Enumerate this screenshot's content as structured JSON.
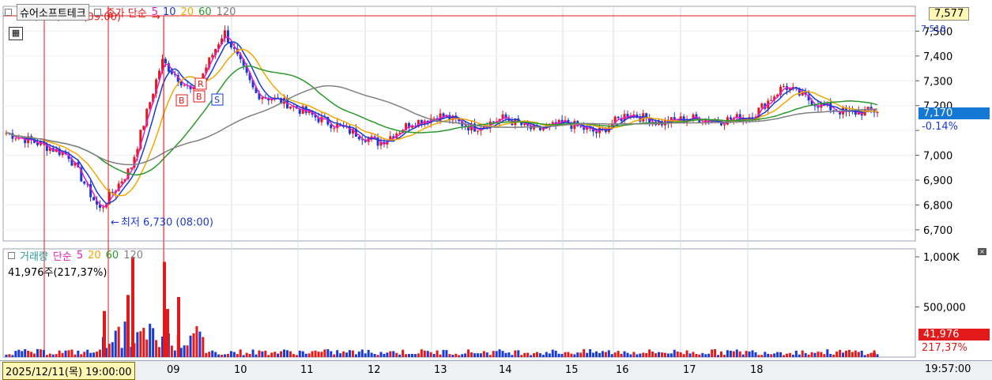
{
  "stock_name": "슈어소프트테크",
  "price_legend": {
    "label": "종가 단순",
    "ma": [
      "5",
      "10",
      "20",
      "60",
      "120"
    ]
  },
  "volume_legend": {
    "label": "거래량",
    "ma_label": "단순",
    "ma": [
      "5",
      "20",
      "60",
      "120"
    ]
  },
  "volume_info": "41,976주(217,37%)",
  "high_annotation": "최고 7,560 (09:00)",
  "low_annotation": "최저 6,730 (08:00)",
  "right_tags": {
    "ref_price": "7,577",
    "small_label": "7,510",
    "current_price": "7,170",
    "change_pct": "-0.14%",
    "volume": "41,976",
    "volume_pct": "217,37%",
    "time": "19:57:00"
  },
  "x_axis": {
    "cursor_label": "2025/12/11(목) 19:00:00",
    "dates": [
      "09",
      "10",
      "11",
      "12",
      "13",
      "14",
      "15",
      "16",
      "17",
      "18"
    ]
  },
  "colors": {
    "up": "#e21a1a",
    "down": "#1a3ad6",
    "ma5": "#e81ec4",
    "ma10": "#1a3ad6",
    "ma20": "#f2a800",
    "ma60": "#2a9a2a",
    "ma120": "#808080"
  },
  "signals": [
    "R",
    "B",
    "B",
    "S"
  ],
  "chart_data": [
    {
      "type": "line",
      "name": "price",
      "yticks": [
        6700,
        6800,
        6900,
        7000,
        7100,
        7200,
        7300,
        7400,
        7500
      ],
      "ytick_labels": [
        "6,700",
        "6,800",
        "6,900",
        "7,000",
        "",
        "7,200",
        "7,300",
        "7,400",
        "7,500"
      ],
      "ylim": [
        6655,
        7600
      ],
      "x": [
        "08",
        "09",
        "10",
        "11",
        "12",
        "13",
        "14",
        "15",
        "16",
        "17",
        "18"
      ],
      "close_anchors": [
        7090,
        7050,
        7000,
        6780,
        6950,
        7380,
        7250,
        7500,
        7250,
        7210,
        7150,
        7100,
        7050,
        7130,
        7160,
        7110,
        7150,
        7100,
        7130,
        7090,
        7170,
        7130,
        7150,
        7140,
        7160,
        7280,
        7210,
        7170,
        7180
      ],
      "high": 7560,
      "low": 6730,
      "last": 7170,
      "change_pct": -0.14
    },
    {
      "type": "bar",
      "name": "volume",
      "yticks": [
        500000,
        1000000
      ],
      "ytick_labels": [
        "500,000",
        "1,000K"
      ],
      "ylim": [
        0,
        1080000
      ],
      "spikes": [
        950000,
        1000000,
        620000,
        600000,
        480000,
        460000
      ],
      "last": 41976
    }
  ]
}
